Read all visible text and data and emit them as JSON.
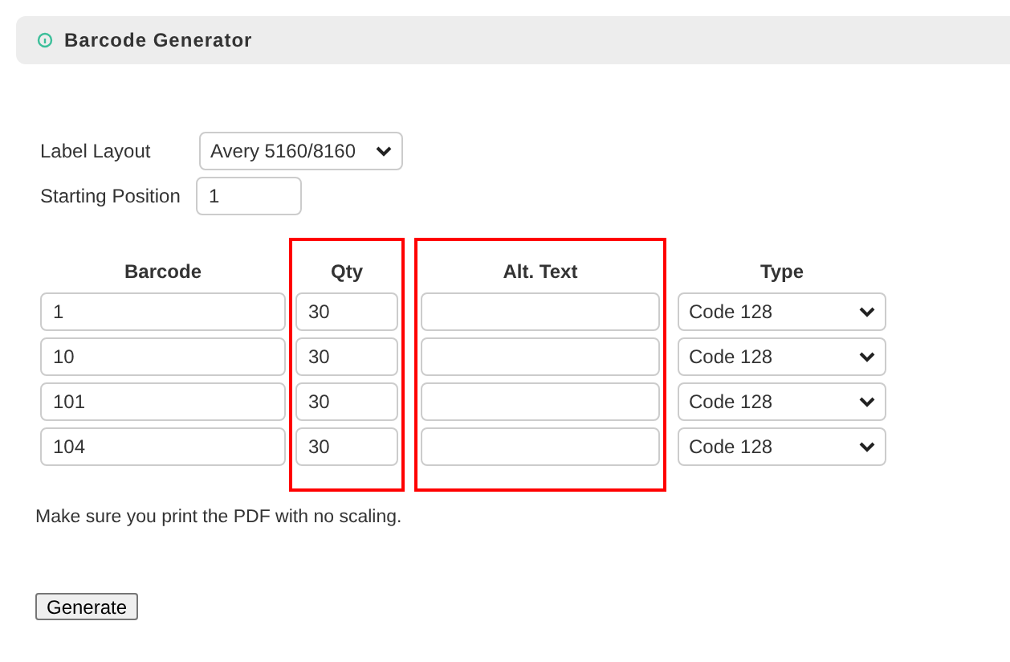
{
  "header": {
    "title": "Barcode Generator"
  },
  "label_layout": {
    "label": "Label Layout",
    "value": "Avery 5160/8160"
  },
  "starting_position": {
    "label": "Starting Position",
    "value": "1"
  },
  "columns": [
    {
      "kind": "text",
      "heading": "Barcode",
      "highlighted": false
    },
    {
      "kind": "text",
      "heading": "Qty",
      "highlighted": true
    },
    {
      "kind": "text",
      "heading": "Alt. Text",
      "highlighted": true
    },
    {
      "kind": "select",
      "heading": "Type",
      "highlighted": false
    }
  ],
  "rows": [
    {
      "barcode": "1",
      "qty": "30",
      "type": "Code 128"
    },
    {
      "barcode": "10",
      "qty": "30",
      "type": "Code 128"
    },
    {
      "barcode": "101",
      "qty": "30",
      "type": "Code 128"
    },
    {
      "barcode": "104",
      "qty": "30",
      "type": "Code 128"
    }
  ],
  "note": "Make sure you print the PDF with no scaling.",
  "button": "Generate"
}
